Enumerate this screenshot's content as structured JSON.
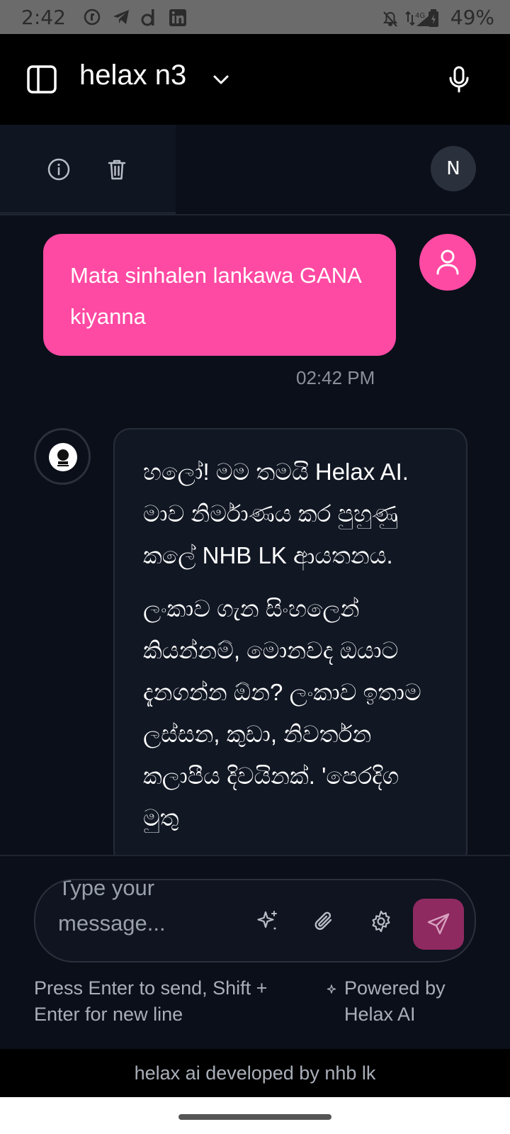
{
  "status_bar": {
    "time": "2:42",
    "battery": "49%",
    "app_icons": [
      "facebook-icon",
      "telegram-icon",
      "d-app-icon",
      "linkedin-icon"
    ],
    "system_icons": [
      "mute-icon",
      "network-4g-icon",
      "signal-icon",
      "battery-icon"
    ]
  },
  "header": {
    "title": "helax n3",
    "icons": [
      "sidebar-toggle-icon",
      "chevron-down-icon",
      "microphone-icon"
    ]
  },
  "toolbar": {
    "user_initial": "N",
    "icons": [
      "info-icon",
      "trash-icon"
    ]
  },
  "chat": {
    "user_message": {
      "text": "Mata sinhalen lankawa GANA kiyanna",
      "time": "02:42 PM"
    },
    "bot_message": {
      "paragraphs": [
        "හලෝ! මම තමයි Helax AI. මාව නිර්මාණය කර පුහුණු කලේ NHB LK ආයතනය.",
        "ලංකාව ගැන සිංහලෙන් කියන්නම්, මොනවද ඔයාට දැනගන්න ඕන? ලංකාව ඉතාම ලස්සන, කුඩා, නිවර්තන කලාපීය දිවයිනක්. 'පෙරදිග මුතු"
      ]
    }
  },
  "composer": {
    "placeholder": "Type your message...",
    "hint": "Press Enter to send, Shift + Enter for new line",
    "powered_by": "Powered by Helax AI",
    "icons": [
      "sparkle-icon",
      "paperclip-icon",
      "gear-icon",
      "send-icon"
    ]
  },
  "footer": {
    "text": "helax ai developed by nhb lk"
  },
  "colors": {
    "accent": "#ff4aa3",
    "send_button": "#8e2a60",
    "background": "#0b0f1a"
  }
}
